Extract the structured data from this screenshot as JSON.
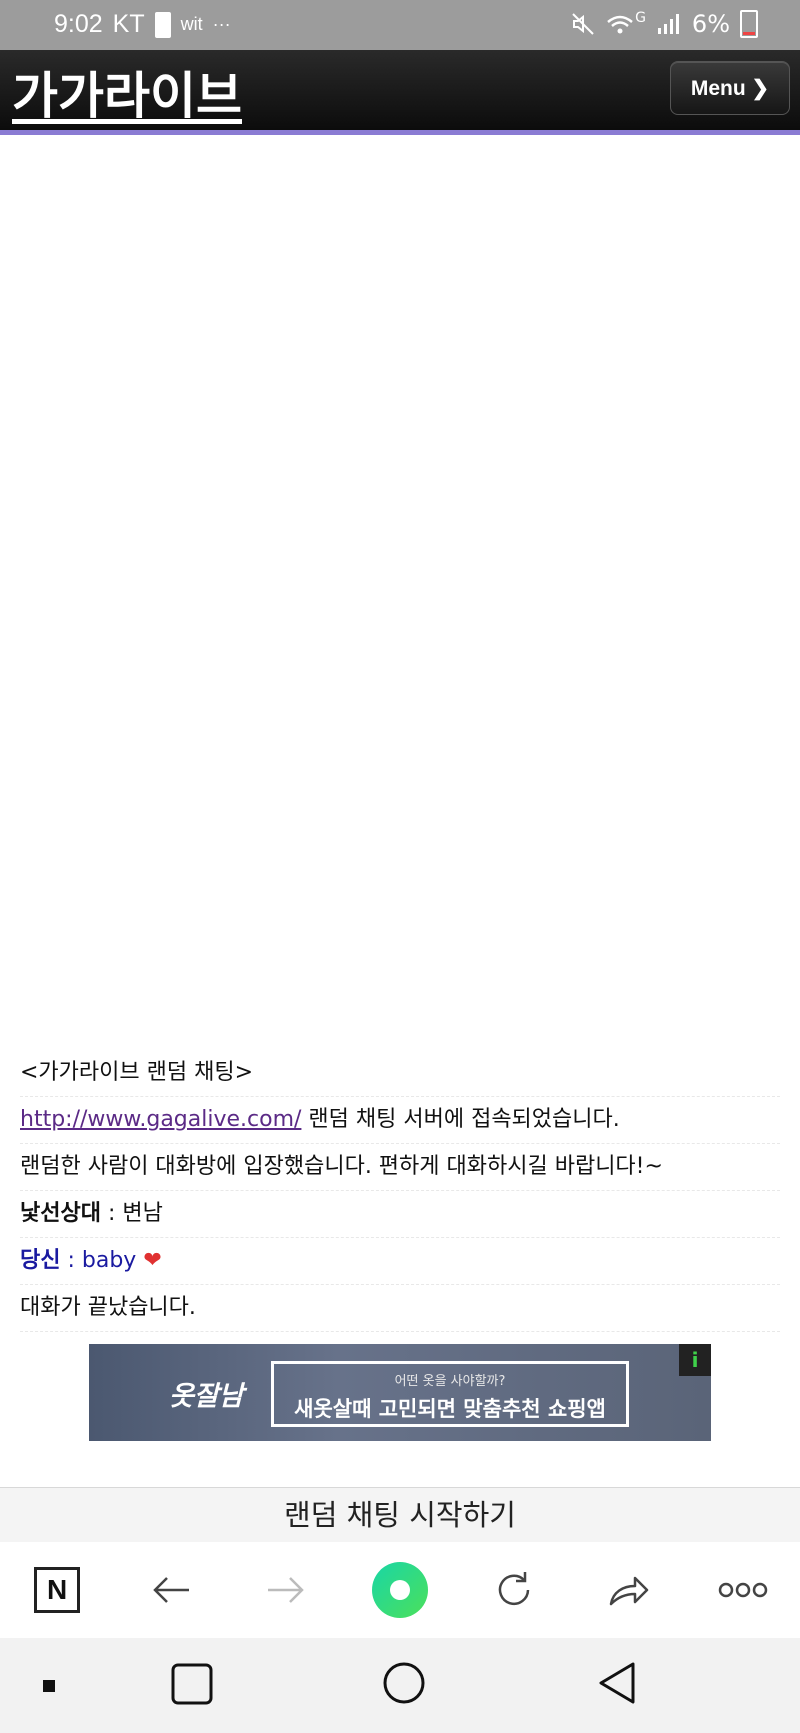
{
  "status_bar": {
    "time": "9:02",
    "carrier": "KT",
    "app_label": "wit",
    "more": "···",
    "network": "G",
    "battery": "6%"
  },
  "header": {
    "title": "가가라이브",
    "menu_label": "Menu ❯"
  },
  "chat": {
    "intro": "<가가라이브 랜덤 채팅>",
    "server_link": "http://www.gagalive.com/",
    "server_msg": " 랜덤 채팅 서버에 접속되었습니다.",
    "enter_msg": "랜덤한 사람이 대화방에 입장했습니다. 편하게 대화하시길 바랍니다!~",
    "stranger_label": "낯선상대",
    "stranger_msg": " : 변남",
    "you_label": "당신",
    "you_msg": " : baby ",
    "heart": "❤",
    "end_msg": "대화가 끝났습니다."
  },
  "ad": {
    "brand": "옷잘남",
    "sub": "어떤 옷을 사야할까?",
    "main": "새옷살때 고민되면 맞춤추천 쇼핑앱",
    "info": "i"
  },
  "start_button": "랜덤 채팅 시작하기",
  "toolbar": {
    "naver": "N"
  },
  "colors": {
    "header_bg": "#111111",
    "header_border": "#8a7bd3",
    "link": "#5b2a86",
    "you": "#1a1aa0",
    "accent_green": "#3ddc84"
  }
}
